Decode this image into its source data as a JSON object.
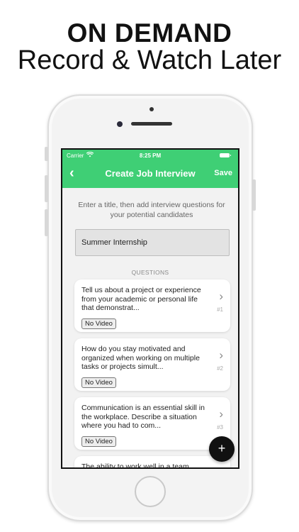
{
  "banner": {
    "line1": "ON DEMAND",
    "line2": "Record & Watch Later"
  },
  "status_bar": {
    "carrier": "Carrier",
    "wifi_icon": "wifi-icon",
    "time": "8:25 PM",
    "battery_icon": "battery-icon"
  },
  "nav": {
    "back_icon": "chevron-left-icon",
    "back_glyph": "‹",
    "title": "Create Job Interview",
    "save_label": "Save"
  },
  "intro_text": "Enter a title, then add interview questions for your potential candidates",
  "title_field": {
    "value": "Summer Internship",
    "placeholder": ""
  },
  "questions_label": "QUESTIONS",
  "questions": [
    {
      "text": "Tell us about a project or experience from your academic or personal life that demonstrat...",
      "number": "#1",
      "badge": "No Video"
    },
    {
      "text": "How do you stay motivated and organized when working on multiple tasks or projects simult...",
      "number": "#2",
      "badge": "No Video"
    },
    {
      "text": "Communication is an essential skill in the workplace. Describe a situation where you had to com...",
      "number": "#3",
      "badge": "No Video"
    },
    {
      "text": "The ability to work well in a team",
      "number": "",
      "badge": ""
    }
  ],
  "fab": {
    "label": "+",
    "icon": "plus-icon"
  },
  "colors": {
    "accent": "#3fcf75",
    "fab": "#111111"
  }
}
